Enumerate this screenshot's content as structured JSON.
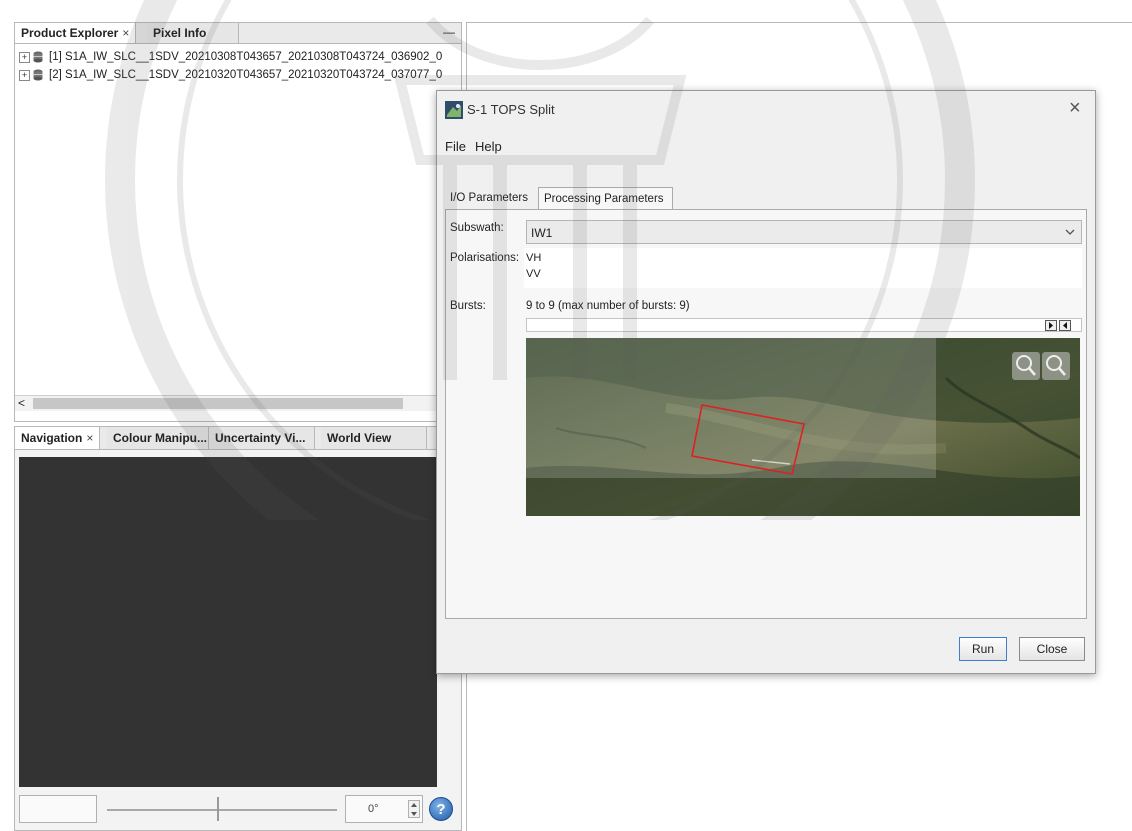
{
  "product_explorer": {
    "tabs": [
      {
        "label": "Product Explorer",
        "close": "×"
      },
      {
        "label": "Pixel Info"
      }
    ],
    "minimize": "—",
    "products": [
      {
        "label": "[1] S1A_IW_SLC__1SDV_20210308T043657_20210308T043724_036902_0"
      },
      {
        "label": "[2] S1A_IW_SLC__1SDV_20210320T043657_20210320T043724_037077_0"
      }
    ],
    "scroll_left": "<"
  },
  "navigation": {
    "tabs": [
      {
        "label": "Navigation",
        "close": "×"
      },
      {
        "label": "Colour Manipu..."
      },
      {
        "label": "Uncertainty Vi..."
      },
      {
        "label": "World View"
      }
    ],
    "rotation_value": "0°",
    "help_icon": "?"
  },
  "dialog": {
    "title": "S-1 TOPS Split",
    "close": "×",
    "menu": [
      "File",
      "Help"
    ],
    "tabs": [
      "I/O Parameters",
      "Processing Parameters"
    ],
    "subswath_label": "Subswath:",
    "subswath_value": "IW1",
    "polarisations_label": "Polarisations:",
    "polarisations": [
      "VH",
      "VV"
    ],
    "bursts_label": "Bursts:",
    "bursts_value": "9 to 9 (max number of bursts: 9)",
    "run_button": "Run",
    "close_button": "Close"
  },
  "colors": {
    "nav_canvas": "#333333",
    "footprint": "#e02020",
    "run_border": "#3c7fd1"
  }
}
